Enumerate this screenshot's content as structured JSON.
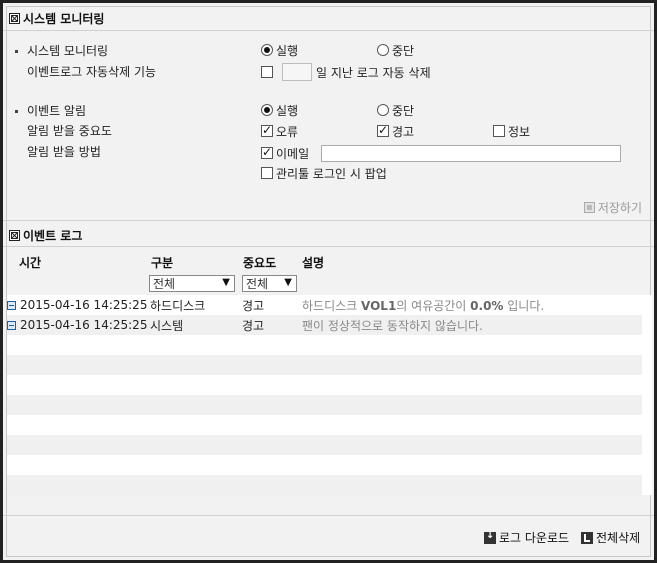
{
  "monitoring": {
    "title": "시스템 모니터링",
    "system_monitoring_label": "시스템 모니터링",
    "auto_delete_label": "이벤트로그 자동삭제 기능",
    "run_label": "실행",
    "stop_label": "중단",
    "selected": "run",
    "auto_delete_checked": false,
    "auto_delete_days": "",
    "auto_delete_suffix": "일 지난 로그 자동 삭제"
  },
  "alarm": {
    "event_alarm_label": "이벤트 알림",
    "run_label": "실행",
    "stop_label": "중단",
    "selected": "run",
    "severity_label": "알림 받을 중요도",
    "severity_options": [
      {
        "label": "오류",
        "checked": true
      },
      {
        "label": "경고",
        "checked": true
      },
      {
        "label": "정보",
        "checked": false
      }
    ],
    "method_label": "알림 받을 방법",
    "email_label": "이메일",
    "email_checked": true,
    "email_value": "",
    "popup_label": "관리툴 로그인 시 팝업",
    "popup_checked": false,
    "save_label": "저장하기"
  },
  "event_log": {
    "title": "이벤트 로그",
    "columns": {
      "time": "시간",
      "category": "구분",
      "severity": "중요도",
      "description": "설명"
    },
    "category_filter": "전체",
    "severity_filter": "전체",
    "rows": [
      {
        "time": "2015-04-16 14:25:25",
        "category": "하드디스크",
        "severity": "경고",
        "desc_pre": "하드디스크 ",
        "desc_bold1": "VOL1",
        "desc_mid": "의 여유공간이 ",
        "desc_bold2": "0.0%",
        "desc_post": " 입니다."
      },
      {
        "time": "2015-04-16 14:25:25",
        "category": "시스템",
        "severity": "경고",
        "desc_pre": "팬이 정상적으로 동작하지 않습니다.",
        "desc_bold1": "",
        "desc_mid": "",
        "desc_bold2": "",
        "desc_post": ""
      }
    ],
    "download_label": "로그 다운로드",
    "delete_all_label": "전체삭제"
  }
}
